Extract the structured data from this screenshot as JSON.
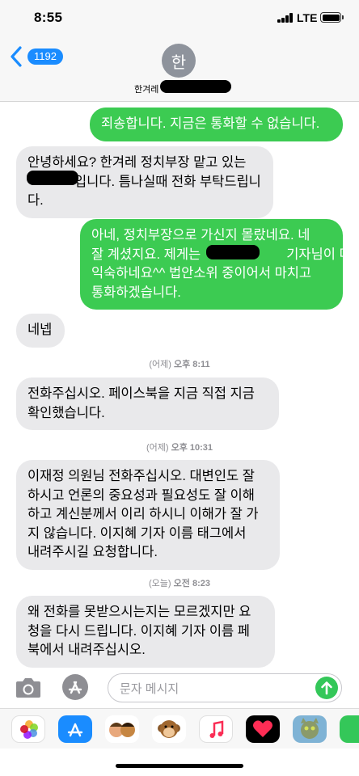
{
  "status_bar": {
    "time": "8:55",
    "network": "LTE",
    "battery_icon": "battery-icon",
    "signal_icon": "signal-icon"
  },
  "header": {
    "back_badge": "1192",
    "avatar_initial": "한",
    "contact_name": "한겨레"
  },
  "messages": [
    {
      "type": "outgoing",
      "lines": [
        "죄송합니다. 지금은 통화할 수 없습니다."
      ]
    },
    {
      "type": "incoming",
      "lines": [
        "안녕하세요? 한겨레 정치부장 맡고 있는",
        "입니다. 틈나실때 전화 부탁드립니",
        "다."
      ]
    },
    {
      "type": "outgoing",
      "lines": [
        "아네, 정치부장으로 가신지 몰랐네요. 네",
        "잘 계셨지요. 제게는",
        "기자님이 더",
        "익숙하네요^^  법안소위 중이어서 마치고",
        "통화하겠습니다."
      ]
    },
    {
      "type": "incoming",
      "lines": [
        "네넵"
      ]
    },
    {
      "type": "incoming",
      "lines": [
        "전화주십시오. 페이스북을 지금 직접 지금",
        "확인했습니다."
      ]
    },
    {
      "type": "incoming",
      "lines": [
        "이재정 의원님 전화주십시오.  대변인도 잘",
        "하시고 언론의 중요성과 필요성도 잘 이해",
        "하고 계신분께서 이리 하시니 이해가 잘 가",
        "지 않습니다. 이지혜 기자 이름 태그에서",
        "내려주시길 요청합니다."
      ]
    },
    {
      "type": "incoming",
      "lines": [
        "왜 전화를 못받으시는지는 모르겠지만  요",
        "청을 다시 드립니다. 이지혜 기자 이름 페",
        "북에서 내려주십시오."
      ]
    }
  ],
  "timestamps": [
    {
      "day": "(어제)",
      "time": "오후 8:11"
    },
    {
      "day": "(어제)",
      "time": "오후 10:31"
    },
    {
      "day": "(오늘)",
      "time": "오전 8:23"
    }
  ],
  "input": {
    "placeholder": "문자 메시지",
    "value": ""
  },
  "colors": {
    "outgoing": "#3ccb52",
    "incoming": "#e9e9eb",
    "accent": "#1a8cff"
  },
  "app_drawer": [
    "photos-app-icon",
    "app-store-icon",
    "memoji-icon",
    "monkey-animoji-icon",
    "music-app-icon",
    "digital-touch-icon",
    "talking-tom-icon",
    "extra-app-icon"
  ]
}
